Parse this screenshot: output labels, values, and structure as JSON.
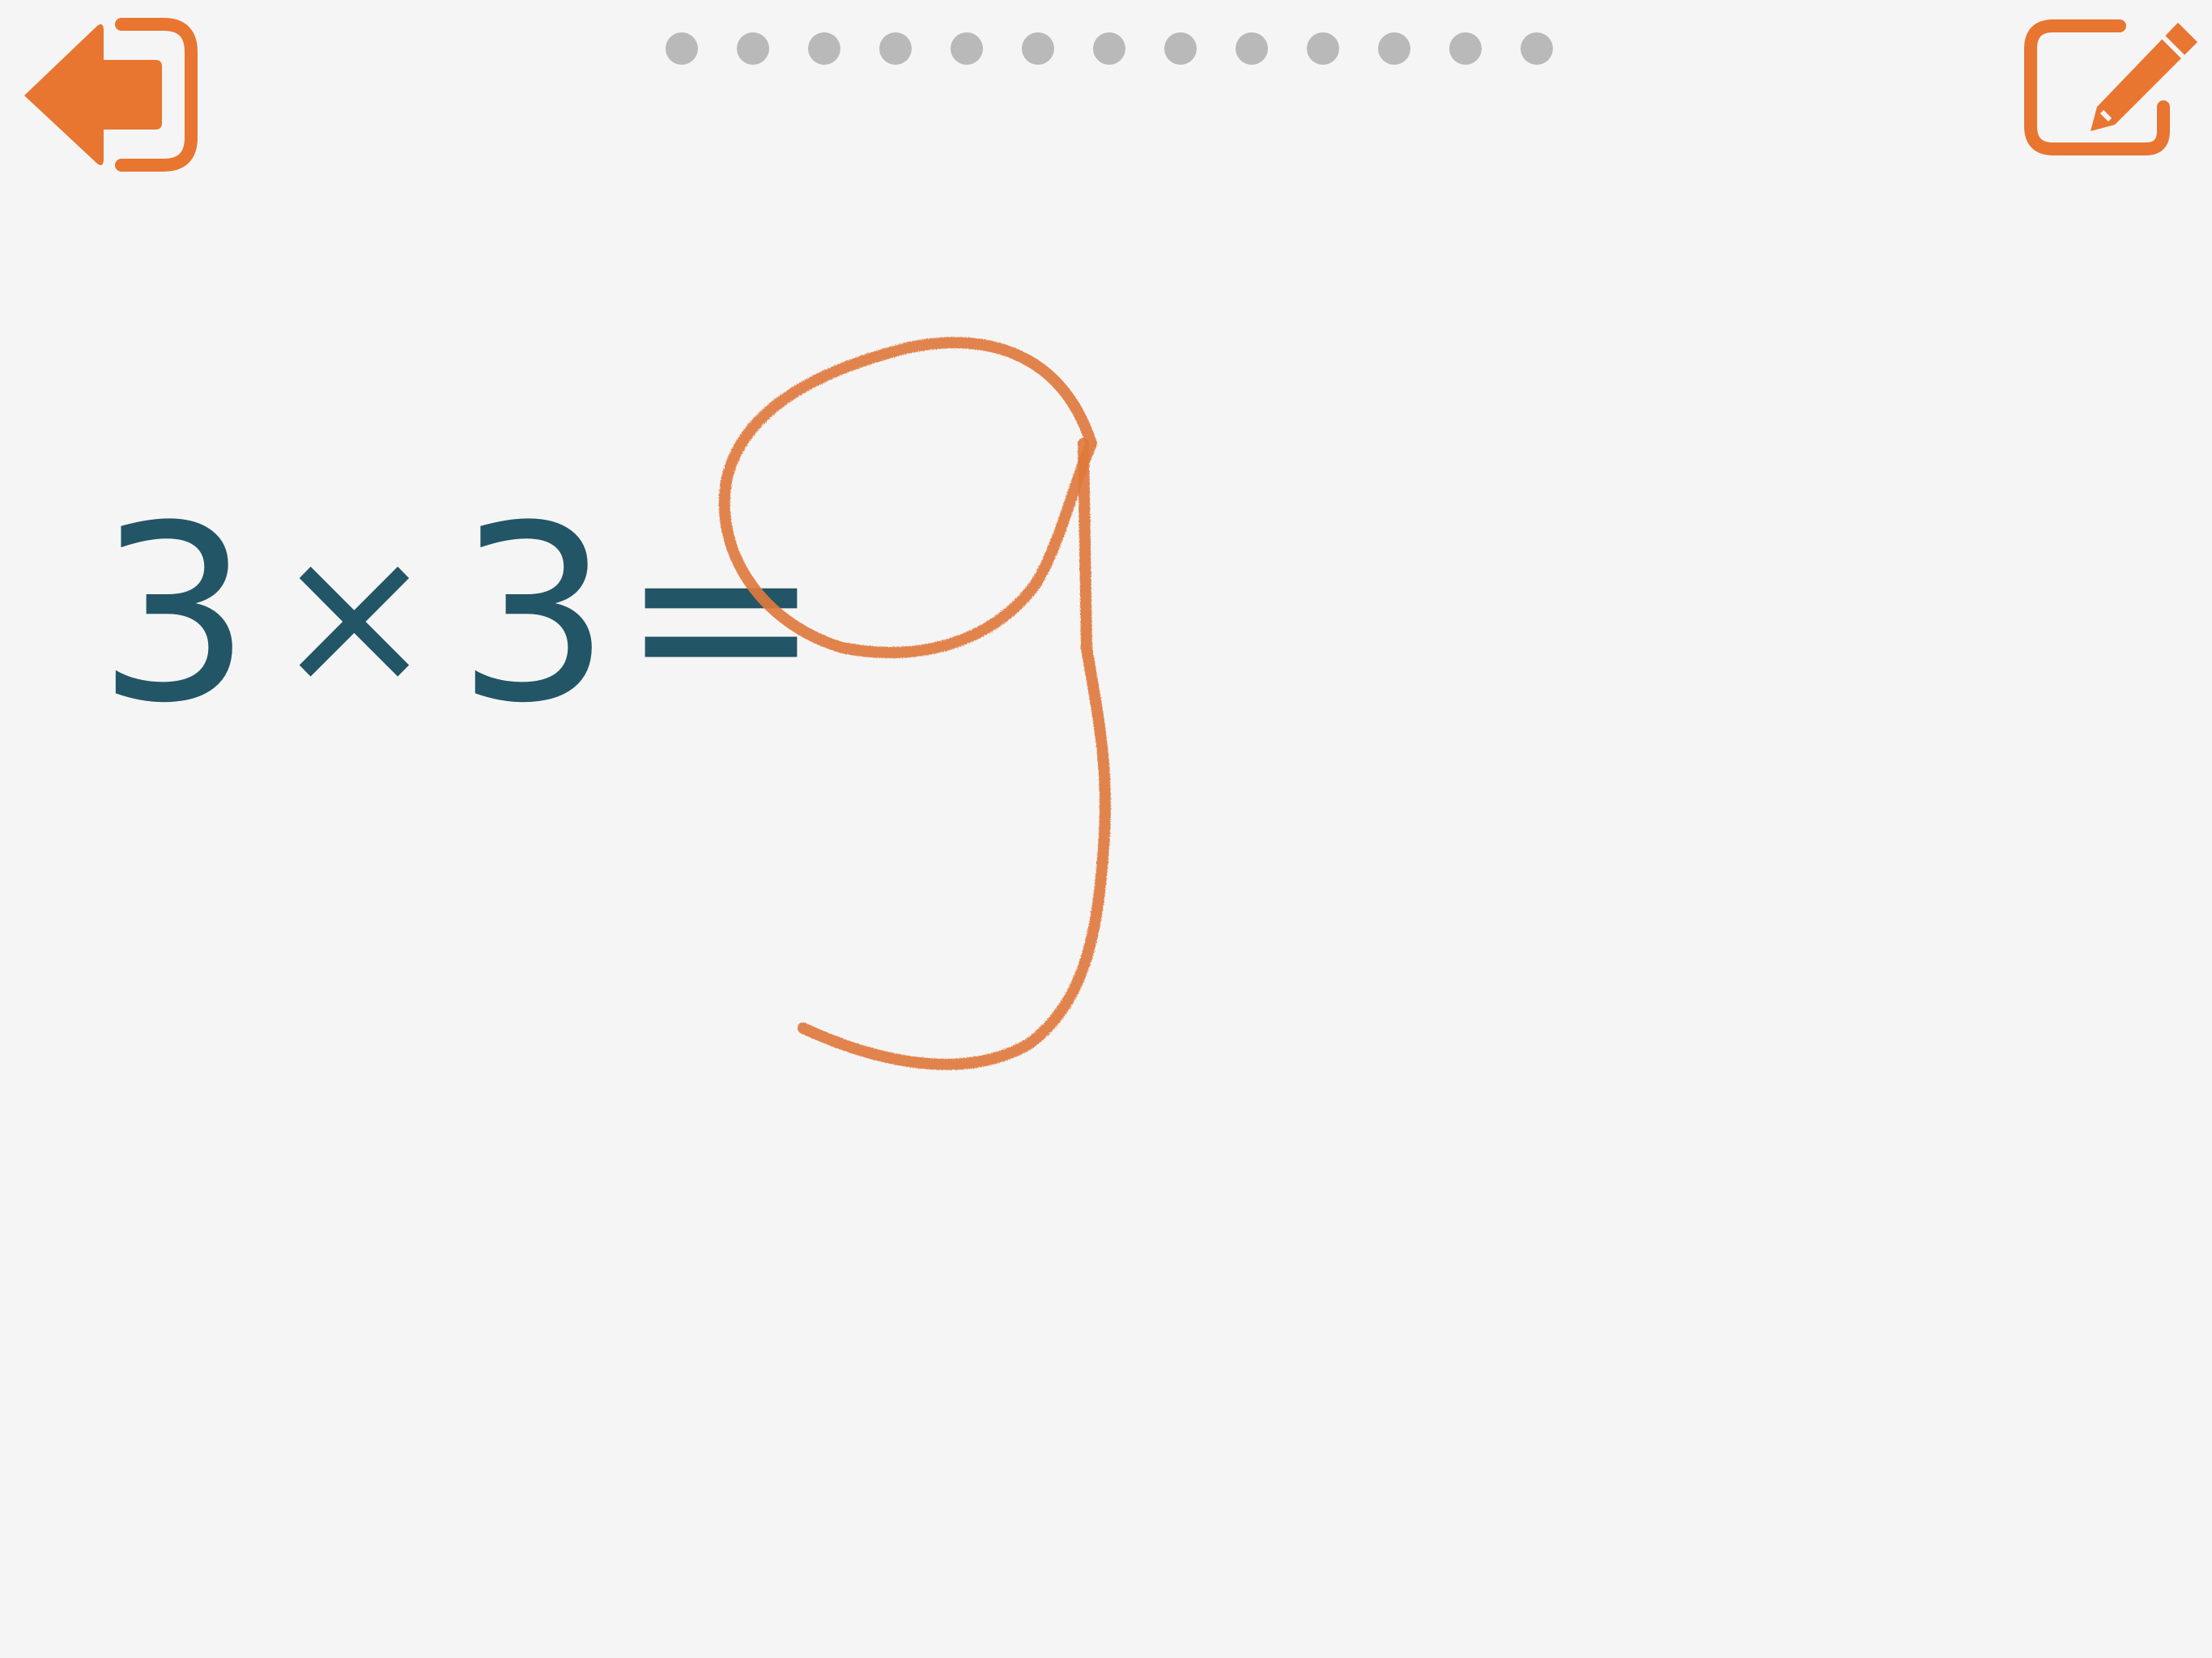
{
  "colors": {
    "accent": "#e87530",
    "equation": "#225566",
    "dot_inactive": "#b9b9b9",
    "background": "#f5f5f5"
  },
  "toolbar": {
    "exit_icon": "exit-arrow-icon",
    "edit_icon": "pencil-edit-icon"
  },
  "progress": {
    "total": 13,
    "current": 0
  },
  "problem": {
    "left_operand": "3",
    "operator": "×",
    "right_operand": "3",
    "equals": "="
  },
  "answer": {
    "handwritten_value": "9"
  }
}
